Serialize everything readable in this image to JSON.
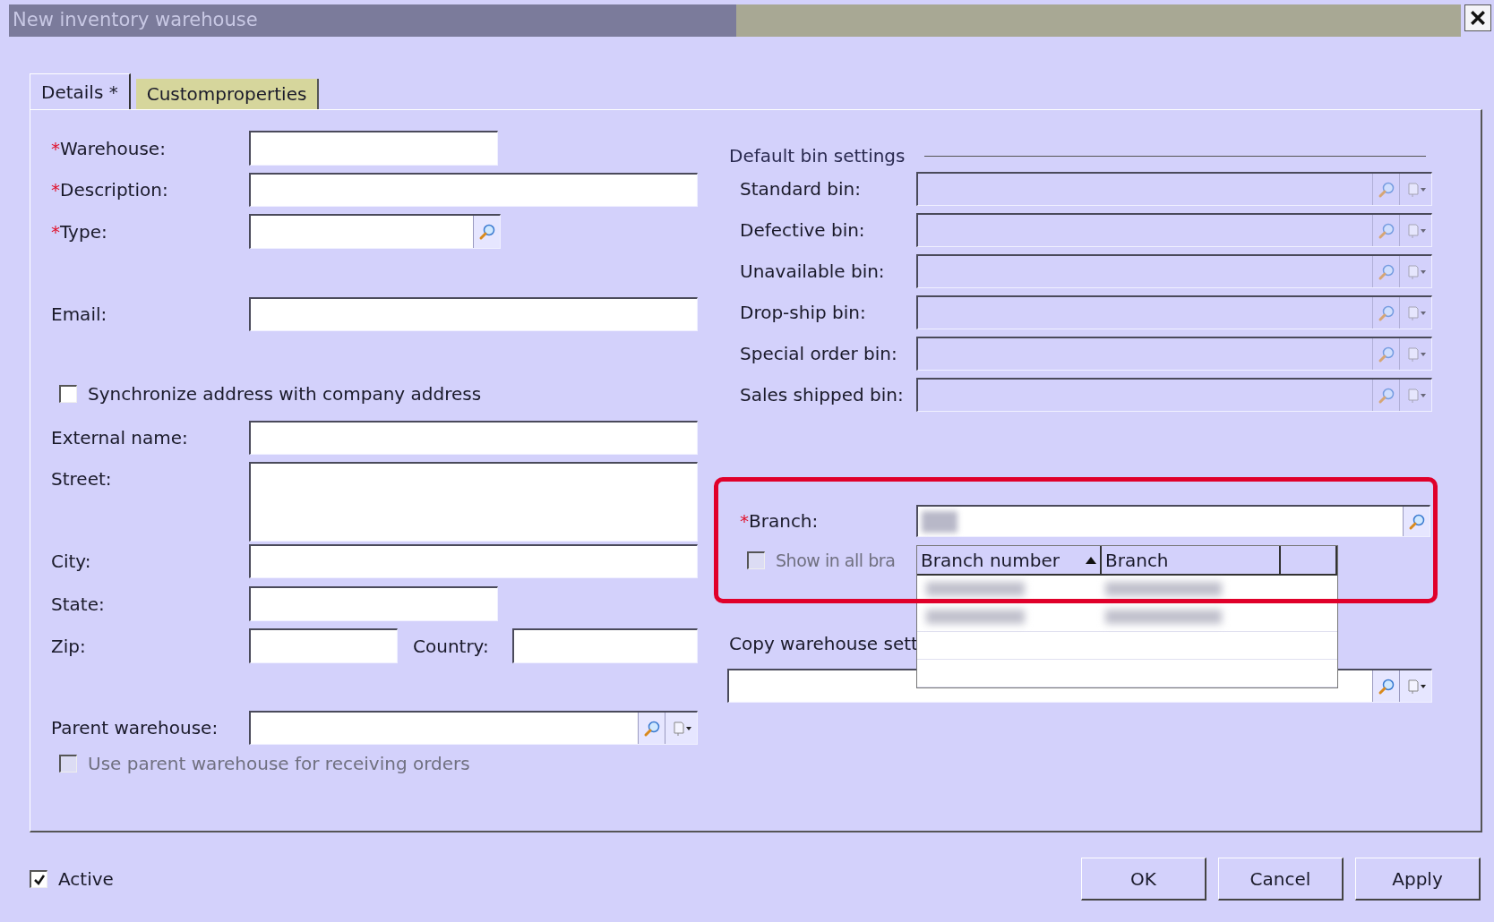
{
  "window": {
    "title": "New inventory warehouse"
  },
  "tabs": [
    {
      "label": "Details *",
      "selected": true
    },
    {
      "label": "Customproperties",
      "selected": false
    }
  ],
  "left_fields": [
    {
      "kind": "short",
      "label": "Warehouse:",
      "required_mark": "*"
    },
    {
      "kind": "long",
      "label": "Description:",
      "required_mark": "*"
    },
    {
      "kind": "lookup",
      "label": "Type:",
      "required_mark": "*"
    },
    {
      "kind": "long",
      "label": "Email:"
    },
    {
      "kind": "checkbox",
      "label": "Synchronize address with company address",
      "checked": false,
      "disabled": false
    },
    {
      "kind": "long",
      "label": "External name:"
    },
    {
      "kind": "multiline",
      "label": "Street:"
    },
    {
      "kind": "long",
      "label": "City:"
    },
    {
      "kind": "short",
      "label": "State:"
    },
    {
      "kind": "pair",
      "label": "Zip:",
      "second_label": "Country:"
    },
    {
      "kind": "lookup-menu",
      "label": "Parent warehouse:"
    },
    {
      "kind": "checkbox",
      "label": "Use parent warehouse for receiving orders",
      "checked": false,
      "disabled": true
    }
  ],
  "bin_settings": {
    "title": "Default bin settings",
    "bins": [
      {
        "label": "Standard bin:",
        "disabled": true
      },
      {
        "label": "Defective bin:",
        "disabled": true
      },
      {
        "label": "Unavailable bin:",
        "disabled": true
      },
      {
        "label": "Drop-ship bin:",
        "disabled": true
      },
      {
        "label": "Special order bin:",
        "disabled": true
      },
      {
        "label": "Sales shipped bin:",
        "disabled": true
      }
    ]
  },
  "branch": {
    "label": "Branch:",
    "required_mark": "*",
    "value_redacted": true,
    "highlighted": true,
    "show_all": {
      "label": "Show in all bra",
      "checked": false,
      "disabled": true
    },
    "dropdown": {
      "columns": [
        {
          "label": "Branch number",
          "sorted": true
        },
        {
          "label": "Branch",
          "sorted": false
        },
        {
          "sorted": false
        }
      ],
      "rows": [
        {
          "kind": "redacted"
        },
        {
          "kind": "redacted"
        },
        {
          "kind": "empty"
        },
        {
          "kind": "empty"
        }
      ]
    }
  },
  "copy_settings": {
    "label": "Copy warehouse sett"
  },
  "active": {
    "label": "Active",
    "checked": true
  },
  "buttons": [
    "OK",
    "Cancel",
    "Apply"
  ]
}
